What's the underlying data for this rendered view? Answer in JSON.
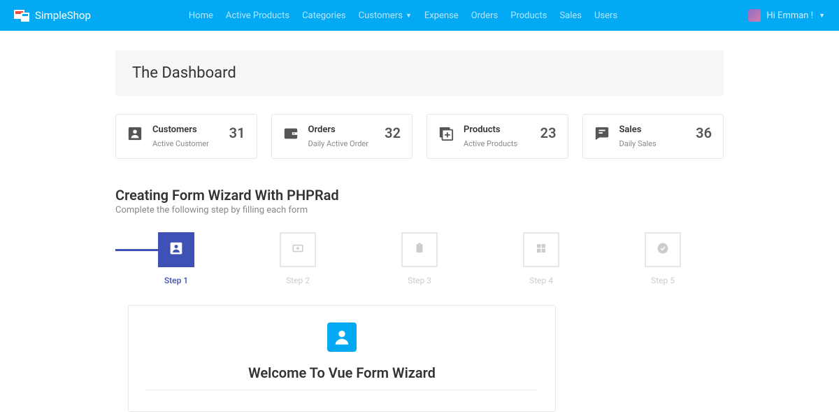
{
  "brand": "SimpleShop",
  "nav": {
    "items": [
      "Home",
      "Active Products",
      "Categories",
      "Customers",
      "Expense",
      "Orders",
      "Products",
      "Sales",
      "Users"
    ],
    "dropdown_index": 3
  },
  "user": {
    "greeting": "Hi Emman !"
  },
  "page": {
    "title": "The Dashboard"
  },
  "stats": [
    {
      "title": "Customers",
      "sub": "Active Customer",
      "value": "31",
      "icon": "person"
    },
    {
      "title": "Orders",
      "sub": "Daily Active Order",
      "value": "32",
      "icon": "wallet"
    },
    {
      "title": "Products",
      "sub": "Active Products",
      "value": "23",
      "icon": "add-box"
    },
    {
      "title": "Sales",
      "sub": "Daily Sales",
      "value": "36",
      "icon": "chat"
    }
  ],
  "wizard": {
    "title": "Creating Form Wizard With PHPRad",
    "subtitle": "Complete the following step by filling each form",
    "steps": [
      {
        "label": "Step 1",
        "icon": "person",
        "active": true
      },
      {
        "label": "Step 2",
        "icon": "add-card",
        "active": false
      },
      {
        "label": "Step 3",
        "icon": "clipboard",
        "active": false
      },
      {
        "label": "Step 4",
        "icon": "grid",
        "active": false
      },
      {
        "label": "Step 5",
        "icon": "check",
        "active": false
      }
    ],
    "content": {
      "heading": "Welcome To Vue Form Wizard"
    }
  }
}
